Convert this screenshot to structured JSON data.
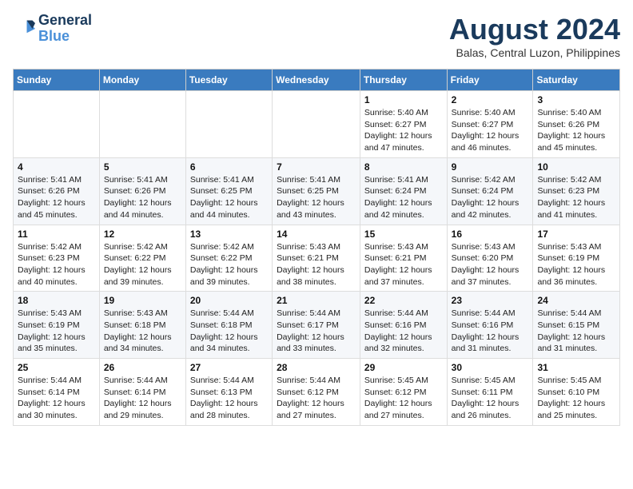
{
  "header": {
    "logo_line1": "General",
    "logo_line2": "Blue",
    "month_title": "August 2024",
    "location": "Balas, Central Luzon, Philippines"
  },
  "weekdays": [
    "Sunday",
    "Monday",
    "Tuesday",
    "Wednesday",
    "Thursday",
    "Friday",
    "Saturday"
  ],
  "weeks": [
    [
      {
        "day": "",
        "text": ""
      },
      {
        "day": "",
        "text": ""
      },
      {
        "day": "",
        "text": ""
      },
      {
        "day": "",
        "text": ""
      },
      {
        "day": "1",
        "text": "Sunrise: 5:40 AM\nSunset: 6:27 PM\nDaylight: 12 hours and 47 minutes."
      },
      {
        "day": "2",
        "text": "Sunrise: 5:40 AM\nSunset: 6:27 PM\nDaylight: 12 hours and 46 minutes."
      },
      {
        "day": "3",
        "text": "Sunrise: 5:40 AM\nSunset: 6:26 PM\nDaylight: 12 hours and 45 minutes."
      }
    ],
    [
      {
        "day": "4",
        "text": "Sunrise: 5:41 AM\nSunset: 6:26 PM\nDaylight: 12 hours and 45 minutes."
      },
      {
        "day": "5",
        "text": "Sunrise: 5:41 AM\nSunset: 6:26 PM\nDaylight: 12 hours and 44 minutes."
      },
      {
        "day": "6",
        "text": "Sunrise: 5:41 AM\nSunset: 6:25 PM\nDaylight: 12 hours and 44 minutes."
      },
      {
        "day": "7",
        "text": "Sunrise: 5:41 AM\nSunset: 6:25 PM\nDaylight: 12 hours and 43 minutes."
      },
      {
        "day": "8",
        "text": "Sunrise: 5:41 AM\nSunset: 6:24 PM\nDaylight: 12 hours and 42 minutes."
      },
      {
        "day": "9",
        "text": "Sunrise: 5:42 AM\nSunset: 6:24 PM\nDaylight: 12 hours and 42 minutes."
      },
      {
        "day": "10",
        "text": "Sunrise: 5:42 AM\nSunset: 6:23 PM\nDaylight: 12 hours and 41 minutes."
      }
    ],
    [
      {
        "day": "11",
        "text": "Sunrise: 5:42 AM\nSunset: 6:23 PM\nDaylight: 12 hours and 40 minutes."
      },
      {
        "day": "12",
        "text": "Sunrise: 5:42 AM\nSunset: 6:22 PM\nDaylight: 12 hours and 39 minutes."
      },
      {
        "day": "13",
        "text": "Sunrise: 5:42 AM\nSunset: 6:22 PM\nDaylight: 12 hours and 39 minutes."
      },
      {
        "day": "14",
        "text": "Sunrise: 5:43 AM\nSunset: 6:21 PM\nDaylight: 12 hours and 38 minutes."
      },
      {
        "day": "15",
        "text": "Sunrise: 5:43 AM\nSunset: 6:21 PM\nDaylight: 12 hours and 37 minutes."
      },
      {
        "day": "16",
        "text": "Sunrise: 5:43 AM\nSunset: 6:20 PM\nDaylight: 12 hours and 37 minutes."
      },
      {
        "day": "17",
        "text": "Sunrise: 5:43 AM\nSunset: 6:19 PM\nDaylight: 12 hours and 36 minutes."
      }
    ],
    [
      {
        "day": "18",
        "text": "Sunrise: 5:43 AM\nSunset: 6:19 PM\nDaylight: 12 hours and 35 minutes."
      },
      {
        "day": "19",
        "text": "Sunrise: 5:43 AM\nSunset: 6:18 PM\nDaylight: 12 hours and 34 minutes."
      },
      {
        "day": "20",
        "text": "Sunrise: 5:44 AM\nSunset: 6:18 PM\nDaylight: 12 hours and 34 minutes."
      },
      {
        "day": "21",
        "text": "Sunrise: 5:44 AM\nSunset: 6:17 PM\nDaylight: 12 hours and 33 minutes."
      },
      {
        "day": "22",
        "text": "Sunrise: 5:44 AM\nSunset: 6:16 PM\nDaylight: 12 hours and 32 minutes."
      },
      {
        "day": "23",
        "text": "Sunrise: 5:44 AM\nSunset: 6:16 PM\nDaylight: 12 hours and 31 minutes."
      },
      {
        "day": "24",
        "text": "Sunrise: 5:44 AM\nSunset: 6:15 PM\nDaylight: 12 hours and 31 minutes."
      }
    ],
    [
      {
        "day": "25",
        "text": "Sunrise: 5:44 AM\nSunset: 6:14 PM\nDaylight: 12 hours and 30 minutes."
      },
      {
        "day": "26",
        "text": "Sunrise: 5:44 AM\nSunset: 6:14 PM\nDaylight: 12 hours and 29 minutes."
      },
      {
        "day": "27",
        "text": "Sunrise: 5:44 AM\nSunset: 6:13 PM\nDaylight: 12 hours and 28 minutes."
      },
      {
        "day": "28",
        "text": "Sunrise: 5:44 AM\nSunset: 6:12 PM\nDaylight: 12 hours and 27 minutes."
      },
      {
        "day": "29",
        "text": "Sunrise: 5:45 AM\nSunset: 6:12 PM\nDaylight: 12 hours and 27 minutes."
      },
      {
        "day": "30",
        "text": "Sunrise: 5:45 AM\nSunset: 6:11 PM\nDaylight: 12 hours and 26 minutes."
      },
      {
        "day": "31",
        "text": "Sunrise: 5:45 AM\nSunset: 6:10 PM\nDaylight: 12 hours and 25 minutes."
      }
    ]
  ]
}
